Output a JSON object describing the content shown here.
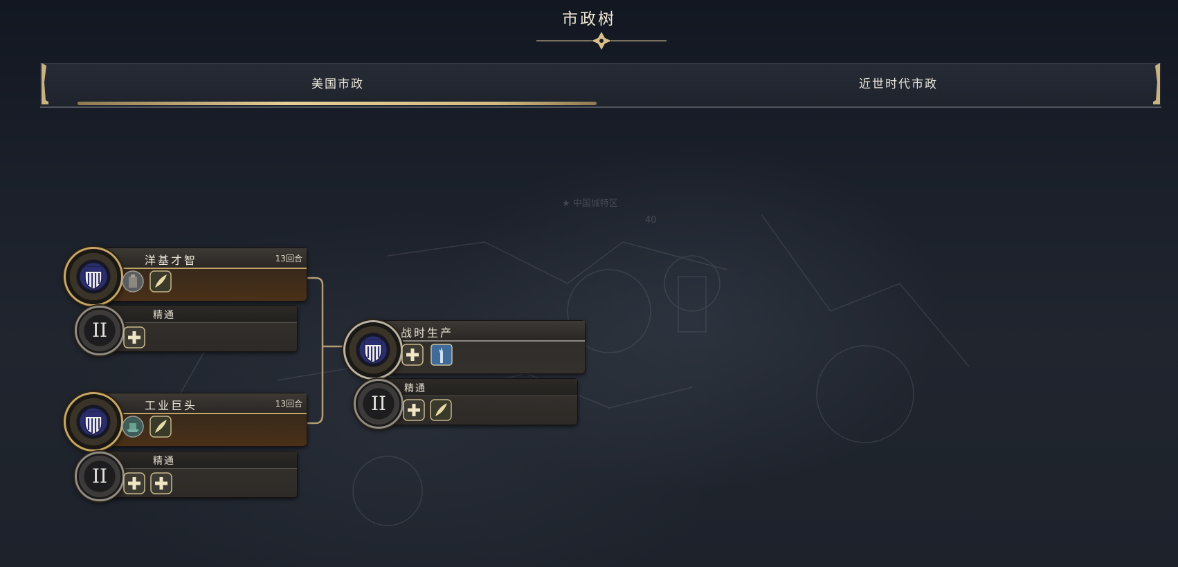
{
  "header": {
    "title": "市政树"
  },
  "tabs": [
    {
      "label": "美国市政",
      "active": true
    },
    {
      "label": "近世时代市政",
      "active": false
    }
  ],
  "map_overlay": {
    "label": "★ 中国城特区",
    "value": "40"
  },
  "civics": {
    "yankee": {
      "name": "洋基才智",
      "turns": "13回合",
      "emblem": "shield-emblem-icon",
      "rewards": [
        "building-icon",
        "quill-icon"
      ],
      "mastery": {
        "name": "精通",
        "emblem": "roman-numeral-two-icon",
        "rewards": [
          "plus-icon"
        ]
      }
    },
    "industrial": {
      "name": "工业巨头",
      "turns": "13回合",
      "emblem": "shield-emblem-icon",
      "rewards": [
        "wonder-icon",
        "quill-icon"
      ],
      "mastery": {
        "name": "精通",
        "emblem": "roman-numeral-two-icon",
        "rewards": [
          "plus-icon",
          "plus-icon"
        ]
      }
    },
    "wartime": {
      "name": "战时生产",
      "turns": "",
      "emblem": "shield-emblem-icon",
      "rewards": [
        "plus-icon",
        "statue-of-liberty-icon"
      ],
      "mastery": {
        "name": "精通",
        "emblem": "roman-numeral-two-icon",
        "rewards": [
          "plus-icon",
          "quill-icon"
        ]
      }
    }
  },
  "colors": {
    "gold": "#c8a765",
    "shield_blue": "#2b2e6e",
    "background": "#1a1f2a"
  }
}
